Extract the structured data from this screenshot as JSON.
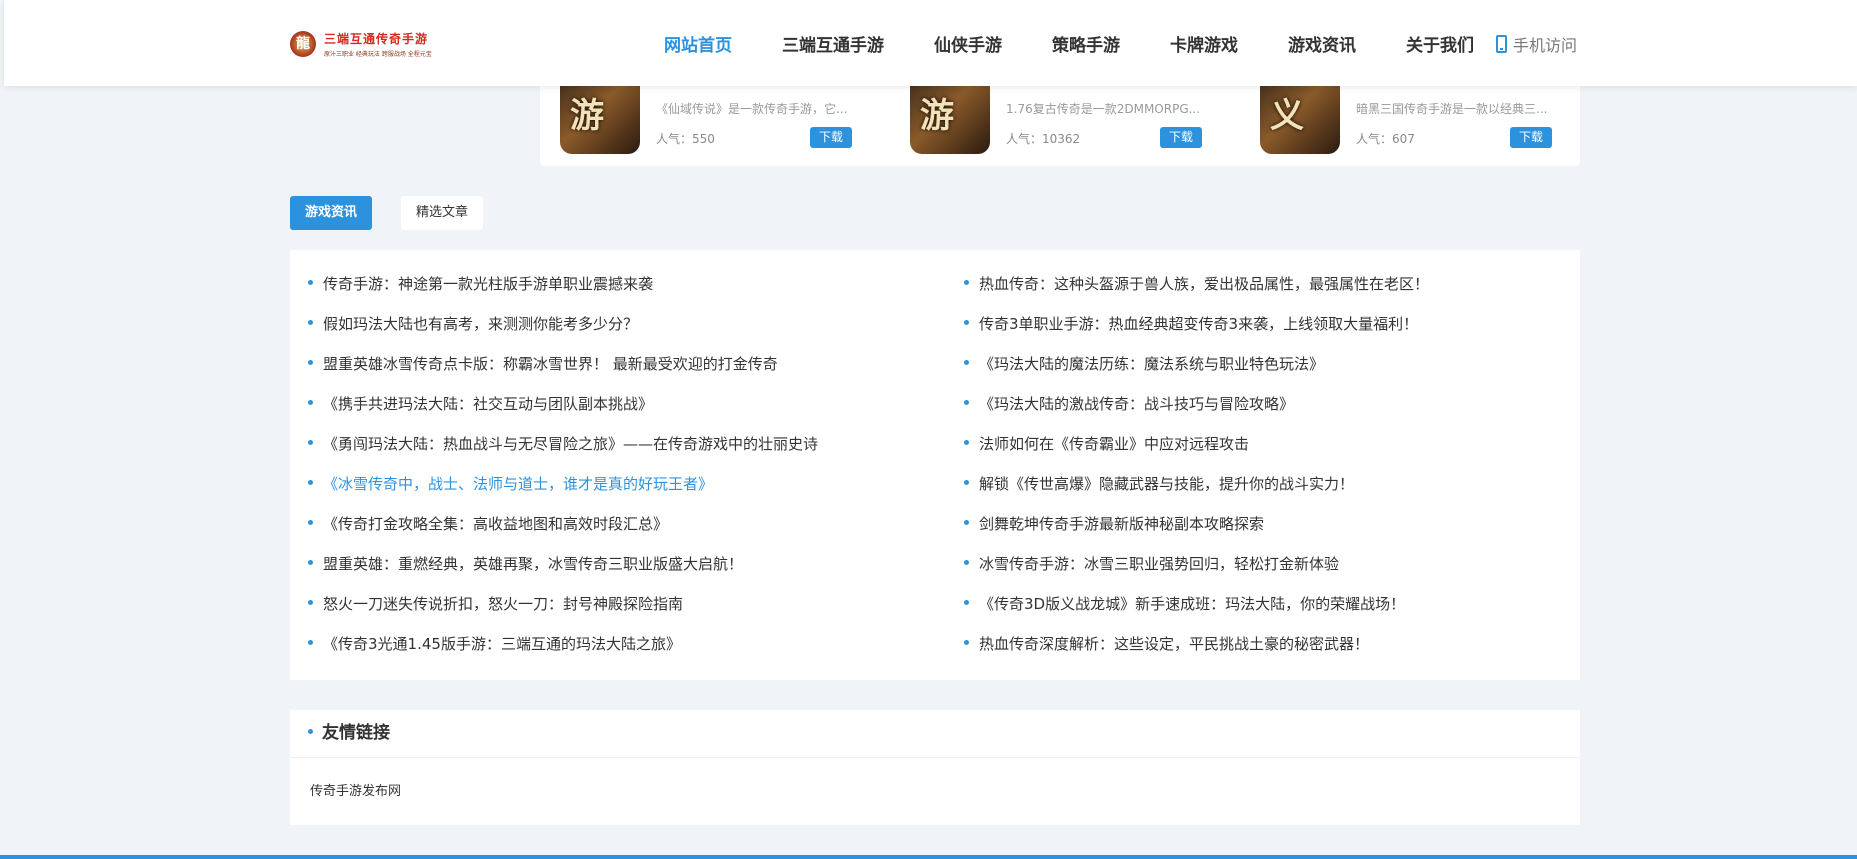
{
  "header": {
    "logo_title": "三端互通传奇手游",
    "logo_subtitle": "原汁三职业 经典玩法 跨服战场 全程元宝",
    "nav": [
      "网站首页",
      "三端互通手游",
      "仙侠手游",
      "策略手游",
      "卡牌游戏",
      "游戏资讯",
      "关于我们"
    ],
    "mobile_label": "手机访问"
  },
  "games": [
    {
      "thumb": "游",
      "desc": "《仙域传说》是一款传奇手游，它...",
      "popularity": "人气：550",
      "download": "下载"
    },
    {
      "thumb": "游",
      "desc": "1.76复古传奇是一款2DMMORPG...",
      "popularity": "人气：10362",
      "download": "下载"
    },
    {
      "thumb": "义",
      "desc": "暗黑三国传奇手游是一款以经典三...",
      "popularity": "人气：607",
      "download": "下载"
    }
  ],
  "tabs": [
    "游戏资讯",
    "精选文章"
  ],
  "articles_left": [
    "传奇手游：神途第一款光柱版手游单职业震撼来袭",
    "假如玛法大陆也有高考，来测测你能考多少分？",
    "盟重英雄冰雪传奇点卡版：称霸冰雪世界！ 最新最受欢迎的打金传奇",
    "《携手共进玛法大陆：社交互动与团队副本挑战》",
    "《勇闯玛法大陆：热血战斗与无尽冒险之旅》——在传奇游戏中的壮丽史诗",
    "《冰雪传奇中，战士、法师与道士，谁才是真的好玩王者》",
    "《传奇打金攻略全集：高收益地图和高效时段汇总》",
    "盟重英雄：重燃经典，英雄再聚，冰雪传奇三职业版盛大启航！",
    "怒火一刀迷失传说折扣，怒火一刀：封号神殿探险指南",
    "《传奇3光通1.45版手游：三端互通的玛法大陆之旅》"
  ],
  "articles_right": [
    "热血传奇：这种头盔源于兽人族，爱出极品属性，最强属性在老区！",
    "传奇3单职业手游：热血经典超变传奇3来袭，上线领取大量福利！",
    "《玛法大陆的魔法历练：魔法系统与职业特色玩法》",
    "《玛法大陆的激战传奇：战斗技巧与冒险攻略》",
    "法师如何在《传奇霸业》中应对远程攻击",
    "解锁《传世高爆》隐藏武器与技能，提升你的战斗实力！",
    "剑舞乾坤传奇手游最新版神秘副本攻略探索",
    "冰雪传奇手游：冰雪三职业强势回归，轻松打金新体验",
    "《传奇3D版义战龙城》新手速成班：玛法大陆，你的荣耀战场！",
    "热血传奇深度解析：这些设定，平民挑战土豪的秘密武器！"
  ],
  "links": {
    "title": "友情链接",
    "items": [
      "传奇手游发布网"
    ]
  },
  "colors": {
    "accent": "#2d92de",
    "background": "#f0f3f7"
  }
}
